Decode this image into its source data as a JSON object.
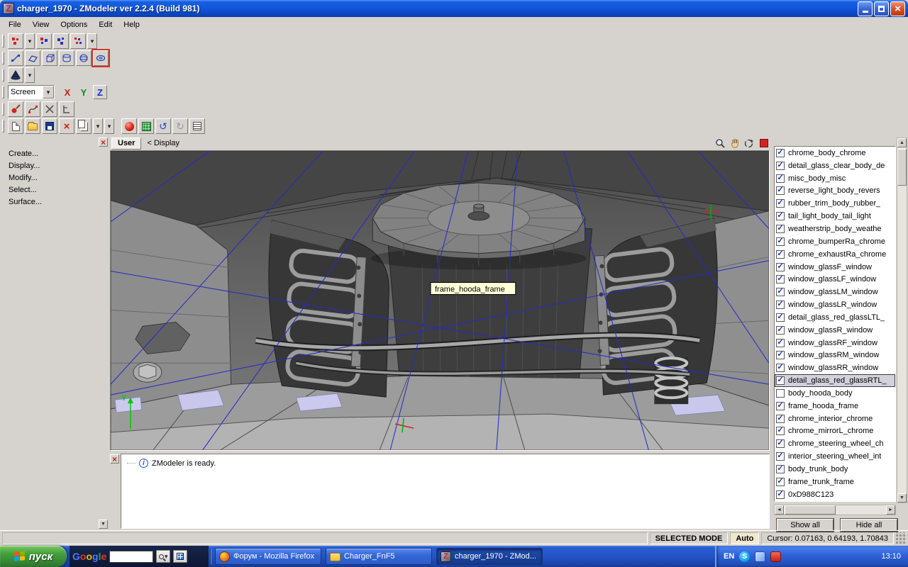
{
  "window": {
    "title": "charger_1970 - ZModeler ver 2.2.4 (Build 981)",
    "menu": [
      "File",
      "View",
      "Options",
      "Edit",
      "Help"
    ]
  },
  "toolbars": {
    "view_combo_value": "Screen",
    "axis_buttons": [
      "X",
      "Y",
      "Z"
    ]
  },
  "command_panel": {
    "items": [
      "Create...",
      "Display...",
      "Modify...",
      "Select...",
      "Surface..."
    ]
  },
  "viewport": {
    "tab_label": "User",
    "breadcrumb": "<  Display",
    "tooltip": "frame_hooda_frame",
    "axis_y_label": "Y"
  },
  "materials_panel": {
    "items": [
      {
        "label": "chrome_body_chrome",
        "checked": true
      },
      {
        "label": "detail_glass_clear_body_de",
        "checked": true
      },
      {
        "label": "misc_body_misc",
        "checked": true
      },
      {
        "label": "reverse_light_body_revers",
        "checked": true
      },
      {
        "label": "rubber_trim_body_rubber_",
        "checked": true
      },
      {
        "label": "tail_light_body_tail_light",
        "checked": true
      },
      {
        "label": "weatherstrip_body_weathe",
        "checked": true
      },
      {
        "label": "chrome_bumperRa_chrome",
        "checked": true
      },
      {
        "label": "chrome_exhaustRa_chrome",
        "checked": true
      },
      {
        "label": "window_glassF_window",
        "checked": true
      },
      {
        "label": "window_glassLF_window",
        "checked": true
      },
      {
        "label": "window_glassLM_window",
        "checked": true
      },
      {
        "label": "window_glassLR_window",
        "checked": true
      },
      {
        "label": "detail_glass_red_glassLTL_",
        "checked": true
      },
      {
        "label": "window_glassR_window",
        "checked": true
      },
      {
        "label": "window_glassRF_window",
        "checked": true
      },
      {
        "label": "window_glassRM_window",
        "checked": true
      },
      {
        "label": "window_glassRR_window",
        "checked": true
      },
      {
        "label": "detail_glass_red_glassRTL_",
        "checked": true,
        "selected": true
      },
      {
        "label": "body_hooda_body",
        "checked": false
      },
      {
        "label": "frame_hooda_frame",
        "checked": true
      },
      {
        "label": "chrome_interior_chrome",
        "checked": true
      },
      {
        "label": "chrome_mirrorL_chrome",
        "checked": true
      },
      {
        "label": "chrome_steering_wheel_ch",
        "checked": true
      },
      {
        "label": "interior_steering_wheel_int",
        "checked": true
      },
      {
        "label": "body_trunk_body",
        "checked": true
      },
      {
        "label": "frame_trunk_frame",
        "checked": true
      },
      {
        "label": "0xD988C123",
        "checked": true
      }
    ],
    "show_all_label": "Show all",
    "hide_all_label": "Hide all"
  },
  "message_bar": {
    "text": "ZModeler is ready."
  },
  "status_bar": {
    "mode_label": "SELECTED MODE",
    "auto_label": "Auto",
    "cursor_label": "Cursor: 0.07163, 0.64193, 1.70843"
  },
  "taskbar": {
    "start_label": "пуск",
    "google_logo": "Google",
    "google_query": "",
    "tasks": [
      {
        "label": "Форум - Mozilla Firefox",
        "icon": "firefox"
      },
      {
        "label": "Charger_FnF5",
        "icon": "folder"
      },
      {
        "label": "charger_1970 - ZMod...",
        "icon": "zmodeler",
        "active": true
      }
    ],
    "tray": {
      "language": "EN",
      "clock": "13:10"
    }
  },
  "colors": {
    "titlebar_blue": "#1257da",
    "taskbar_blue": "#2455c9",
    "start_green": "#46a23c",
    "check_blue": "#2335a8",
    "highlight_red": "#d43425",
    "wireframe_blue": "#2a2ac6"
  }
}
